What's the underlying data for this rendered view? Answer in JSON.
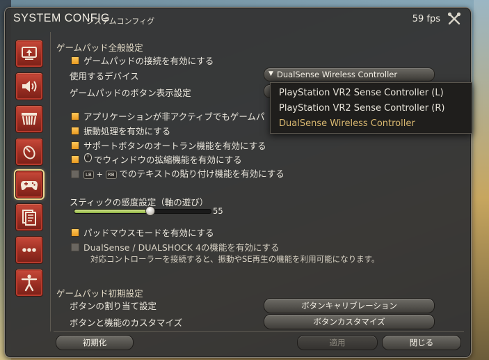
{
  "window": {
    "title_main": "SYSTEM CONFIG",
    "title_sub": "システムコンフィグ",
    "fps": "59 fps",
    "settings_icon": "crossed-tools-icon"
  },
  "sidebar": {
    "items": [
      {
        "icon": "display-icon"
      },
      {
        "icon": "speaker-icon"
      },
      {
        "icon": "theater-icon"
      },
      {
        "icon": "mouse-icon"
      },
      {
        "icon": "gamepad-icon",
        "active": true
      },
      {
        "icon": "document-icon"
      },
      {
        "icon": "more-dots-icon"
      },
      {
        "icon": "accessibility-icon"
      }
    ]
  },
  "general": {
    "heading": "ゲームパッド全般設定",
    "enable_gamepad": "ゲームパッドの接続を有効にする",
    "device_label": "使用するデバイス",
    "device_value": "DualSense Wireless Controller",
    "button_display_label": "ゲームパッドのボタン表示設定",
    "inactive_label": "アプリケーションが非アクティブでもゲームパ",
    "vibration": "振動処理を有効にする",
    "support_autorun": "サポートボタンのオートラン機能を有効にする",
    "window_expand": "でウィンドウの拡縮機能を有効にする",
    "paste_lb": "LB",
    "paste_plus": "+",
    "paste_rb": "RB",
    "paste_text": "でのテキストの貼り付け機能を有効にする",
    "stick_label": "スティックの感度設定（軸の遊び）",
    "stick_value": "55",
    "stick_level": 0.55,
    "pad_mouse": "パッドマウスモードを有効にする",
    "dualsense": "DualSense / DUALSHOCK 4の機能を有効にする",
    "dualsense_note": "対応コントローラーを接続すると、振動やSE再生の機能を利用可能になります。"
  },
  "dropdown_popup": {
    "options": [
      "PlayStation VR2 Sense Controller (L)",
      "PlayStation VR2 Sense Controller (R)",
      "DualSense Wireless Controller"
    ],
    "selected_index": 2
  },
  "initial": {
    "heading": "ゲームパッド初期設定",
    "assign_label": "ボタンの割り当て設定",
    "assign_button": "ボタンキャリブレーション",
    "customize_label": "ボタンと機能のカスタマイズ",
    "customize_button": "ボタンカスタマイズ"
  },
  "footer": {
    "reset": "初期化",
    "apply": "適用",
    "close": "閉じる"
  },
  "colors": {
    "accent_checkbox": "#f0a830",
    "sidebar_red": "#b83a2c",
    "active_glow": "#f0d890",
    "popup_selected": "#d9b870"
  }
}
